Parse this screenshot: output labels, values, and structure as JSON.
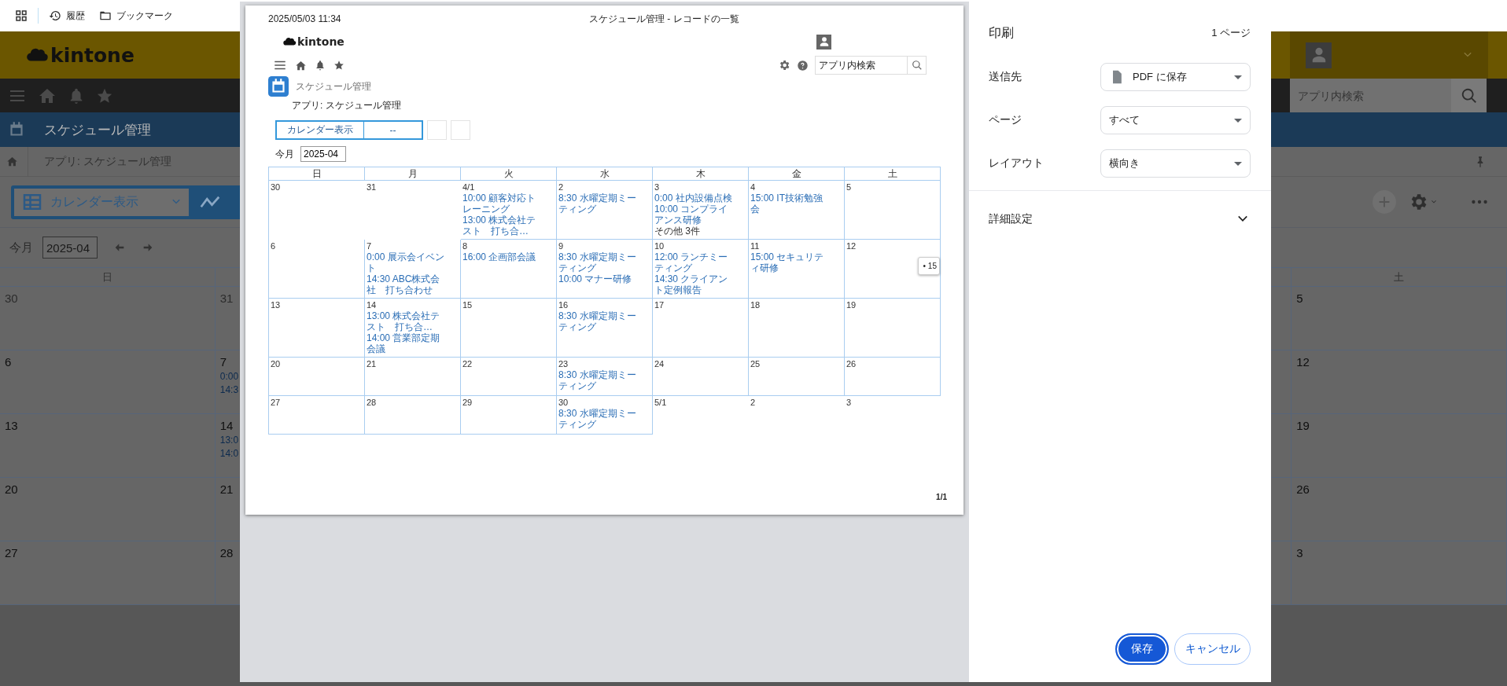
{
  "browser_bar": {
    "items": [
      {
        "label": "履歴",
        "kind": "history"
      },
      {
        "label": "ブックマーク",
        "kind": "bookmarks"
      }
    ]
  },
  "background_page": {
    "logo": "kintone",
    "search": {
      "placeholder": "アプリ内検索"
    },
    "app_title": "スケジュール管理",
    "breadcrumb": "アプリ: スケジュール管理",
    "view_selector": "カレンダー表示",
    "month_label": "今月",
    "month_field": "2025-04",
    "calendar": {
      "sunday_header": "日",
      "saturday_header": "土",
      "weeks": [
        {
          "sunday": {
            "day": "30",
            "grayed": true
          },
          "monday": {
            "day": "31",
            "grayed": true
          },
          "saturday": {
            "day": "5",
            "grayed": false
          }
        },
        {
          "sunday": {
            "day": "6",
            "grayed": false
          },
          "monday": {
            "day": "7",
            "grayed": false,
            "events": [
              "0:00",
              "14:3"
            ]
          },
          "saturday": {
            "day": "12",
            "grayed": false
          }
        },
        {
          "sunday": {
            "day": "13",
            "grayed": false
          },
          "monday": {
            "day": "14",
            "grayed": false,
            "events": [
              "13:0",
              "14:0"
            ]
          },
          "saturday": {
            "day": "19",
            "grayed": false
          }
        },
        {
          "sunday": {
            "day": "20",
            "grayed": false
          },
          "monday": {
            "day": "21",
            "grayed": false
          },
          "saturday": {
            "day": "26",
            "grayed": false
          }
        },
        {
          "sunday": {
            "day": "27",
            "grayed": false
          },
          "monday": {
            "day": "28",
            "grayed": false
          },
          "saturday": {
            "day": "3",
            "grayed": false
          }
        }
      ]
    }
  },
  "print_preview": {
    "timestamp": "2025/05/03 11:34",
    "doc_title": "スケジュール管理 - レコードの一覧",
    "logo": "kintone",
    "search": {
      "placeholder": "アプリ内検索"
    },
    "app_title": "スケジュール管理",
    "breadcrumb": "アプリ: スケジュール管理",
    "view_selector": {
      "label": "カレンダー表示",
      "filter": "--"
    },
    "month_label": "今月",
    "month_field": "2025-04",
    "calendar": {
      "headers": [
        "日",
        "月",
        "火",
        "水",
        "木",
        "金",
        "土"
      ],
      "weeks": [
        {
          "cells": [
            {
              "day": "30",
              "other_month": true
            },
            {
              "day": "31",
              "other_month": true
            },
            {
              "day": "4/1",
              "other_month": false,
              "events": [
                "10:00 顧客対応トレーニング",
                "13:00 株式会社テスト　打ち合…"
              ]
            },
            {
              "day": "2",
              "other_month": false,
              "events": [
                "8:30 水曜定期ミーティング"
              ]
            },
            {
              "day": "3",
              "other_month": false,
              "events": [
                "0:00 社内設備点検",
                "10:00 コンプライアンス研修"
              ],
              "more": "その他 3件"
            },
            {
              "day": "4",
              "other_month": false,
              "events": [
                "15:00 IT技術勉強会"
              ]
            },
            {
              "day": "5",
              "other_month": false
            }
          ]
        },
        {
          "cells": [
            {
              "day": "6",
              "other_month": false
            },
            {
              "day": "7",
              "other_month": false,
              "events": [
                "0:00 展示会イベント",
                "14:30 ABC株式会社　打ち合わせ"
              ]
            },
            {
              "day": "8",
              "other_month": false,
              "events": [
                "16:00 企画部会議"
              ]
            },
            {
              "day": "9",
              "other_month": false,
              "events": [
                "8:30 水曜定期ミーティング",
                "10:00 マナー研修"
              ]
            },
            {
              "day": "10",
              "other_month": false,
              "events": [
                "12:00 ランチミーティング",
                "14:30 クライアント定例報告"
              ]
            },
            {
              "day": "11",
              "other_month": false,
              "events": [
                "15:00 セキュリティ研修"
              ]
            },
            {
              "day": "12",
              "other_month": false,
              "popup": "• 15"
            }
          ]
        },
        {
          "cells": [
            {
              "day": "13",
              "other_month": false
            },
            {
              "day": "14",
              "other_month": false,
              "events": [
                "13:00 株式会社テスト　打ち合…",
                "14:00 営業部定期会議"
              ]
            },
            {
              "day": "15",
              "other_month": false
            },
            {
              "day": "16",
              "other_month": false,
              "events": [
                "8:30 水曜定期ミーティング"
              ]
            },
            {
              "day": "17",
              "other_month": false
            },
            {
              "day": "18",
              "other_month": false
            },
            {
              "day": "19",
              "other_month": false
            }
          ]
        },
        {
          "cells": [
            {
              "day": "20",
              "other_month": false
            },
            {
              "day": "21",
              "other_month": false
            },
            {
              "day": "22",
              "other_month": false
            },
            {
              "day": "23",
              "other_month": false,
              "events": [
                "8:30 水曜定期ミーティング"
              ]
            },
            {
              "day": "24",
              "other_month": false
            },
            {
              "day": "25",
              "other_month": false
            },
            {
              "day": "26",
              "other_month": false
            }
          ]
        },
        {
          "cells": [
            {
              "day": "27",
              "other_month": false
            },
            {
              "day": "28",
              "other_month": false
            },
            {
              "day": "29",
              "other_month": false
            },
            {
              "day": "30",
              "other_month": false,
              "events": [
                "8:30 水曜定期ミーティング"
              ]
            },
            {
              "day": "5/1",
              "other_month": true
            },
            {
              "day": "2",
              "other_month": true
            },
            {
              "day": "3",
              "other_month": true
            }
          ]
        }
      ]
    },
    "page_number": "1/1"
  },
  "print_settings": {
    "title": "印刷",
    "page_count": "1 ページ",
    "fields": [
      {
        "label": "送信先",
        "value": "PDF に保存",
        "kind": "destination"
      },
      {
        "label": "ページ",
        "value": "すべて",
        "kind": "plain"
      },
      {
        "label": "レイアウト",
        "value": "横向き",
        "kind": "plain"
      }
    ],
    "advanced": {
      "label": "詳細設定",
      "expanded": false
    },
    "buttons": [
      {
        "label": "保存",
        "kind": "primary"
      },
      {
        "label": "キャンセル",
        "kind": "secondary"
      }
    ]
  }
}
